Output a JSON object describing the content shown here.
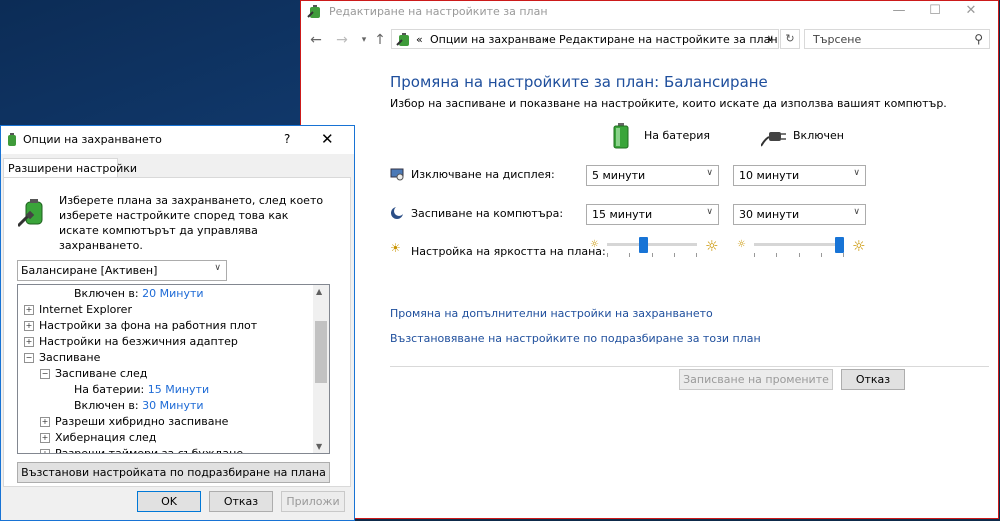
{
  "main": {
    "title": "Редактиране на настройките за план",
    "breadcrumb_sep": "«",
    "breadcrumb": [
      "Опции на захранване",
      "Редактиране на настройките за план"
    ],
    "search_placeholder": "Търсене",
    "heading": "Промяна на настройките за план: Балансиране",
    "subtitle": "Избор на заспиване и показване на настройките, които искате да използва вашият компютър.",
    "col_battery": "На батерия",
    "col_plugged": "Включен",
    "rows": [
      {
        "label": "Изключване на дисплея:",
        "battery": "5 минути",
        "plugged": "10 минути"
      },
      {
        "label": "Заспиване на компютъра:",
        "battery": "15 минути",
        "plugged": "30 минути"
      }
    ],
    "brightness_label": "Настройка на яркостта на плана:",
    "brightness_battery": 0.4,
    "brightness_plugged": 1.0,
    "link_advanced": "Промяна на допълнителни настройки на захранването",
    "link_restore": "Възстановяване на настройките по подразбиране за този план",
    "save_button": "Записване на промените",
    "cancel_button": "Отказ"
  },
  "dialog": {
    "title": "Опции на захранването",
    "help": "?",
    "close": "✕",
    "tab": "Разширени настройки",
    "instructions": "Изберете плана за захранването, след което изберете настройките според това как искате компютърът да управлява захранването.",
    "plan": "Балансиране [Активен]",
    "tree": [
      {
        "label": "Включен в:",
        "value": "20 Минути",
        "level": 3,
        "exp": ""
      },
      {
        "label": "Internet Explorer",
        "value": "",
        "level": 0,
        "exp": "+"
      },
      {
        "label": "Настройки за фона на работния плот",
        "value": "",
        "level": 0,
        "exp": "+"
      },
      {
        "label": "Настройки на безжичния адаптер",
        "value": "",
        "level": 0,
        "exp": "+"
      },
      {
        "label": "Заспиване",
        "value": "",
        "level": 0,
        "exp": "−"
      },
      {
        "label": "Заспиване след",
        "value": "",
        "level": 1,
        "exp": "−"
      },
      {
        "label": "На батерии:",
        "value": "15 Минути",
        "level": 3,
        "exp": ""
      },
      {
        "label": "Включен в:",
        "value": "30 Минути",
        "level": 3,
        "exp": ""
      },
      {
        "label": "Разреши хибридно заспиване",
        "value": "",
        "level": 1,
        "exp": "+"
      },
      {
        "label": "Хибернация след",
        "value": "",
        "level": 1,
        "exp": "+"
      },
      {
        "label": "Разреши таймери за събуждане",
        "value": "",
        "level": 1,
        "exp": "+"
      }
    ],
    "restore_button": "Възстанови настройката по подразбиране на плана",
    "ok_button": "OK",
    "cancel_button": "Отказ",
    "apply_button": "Приложи"
  }
}
